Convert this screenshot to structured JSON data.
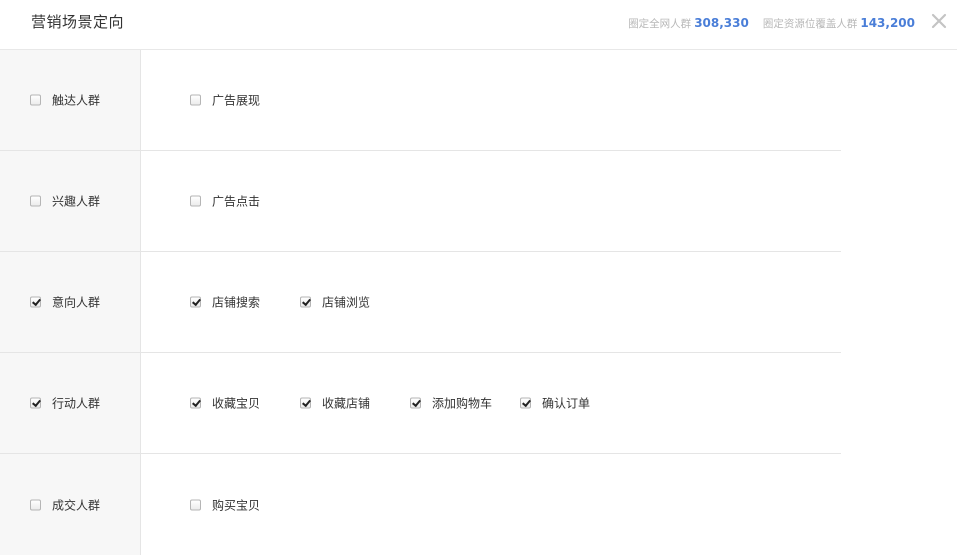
{
  "header": {
    "title": "营销场景定向",
    "stats": [
      {
        "label": "圈定全网人群",
        "value": "308,330"
      },
      {
        "label": "圈定资源位覆盖人群",
        "value": "143,200"
      }
    ],
    "close_icon": "close-icon"
  },
  "groups": [
    {
      "label": "触达人群",
      "checked": false,
      "options": [
        {
          "label": "广告展现",
          "checked": false
        }
      ]
    },
    {
      "label": "兴趣人群",
      "checked": false,
      "options": [
        {
          "label": "广告点击",
          "checked": false
        }
      ]
    },
    {
      "label": "意向人群",
      "checked": true,
      "options": [
        {
          "label": "店铺搜索",
          "checked": true
        },
        {
          "label": "店铺浏览",
          "checked": true
        }
      ]
    },
    {
      "label": "行动人群",
      "checked": true,
      "options": [
        {
          "label": "收藏宝贝",
          "checked": true
        },
        {
          "label": "收藏店铺",
          "checked": true
        },
        {
          "label": "添加购物车",
          "checked": true
        },
        {
          "label": "确认订单",
          "checked": true
        }
      ]
    },
    {
      "label": "成交人群",
      "checked": false,
      "options": [
        {
          "label": "购买宝贝",
          "checked": false
        }
      ]
    }
  ]
}
